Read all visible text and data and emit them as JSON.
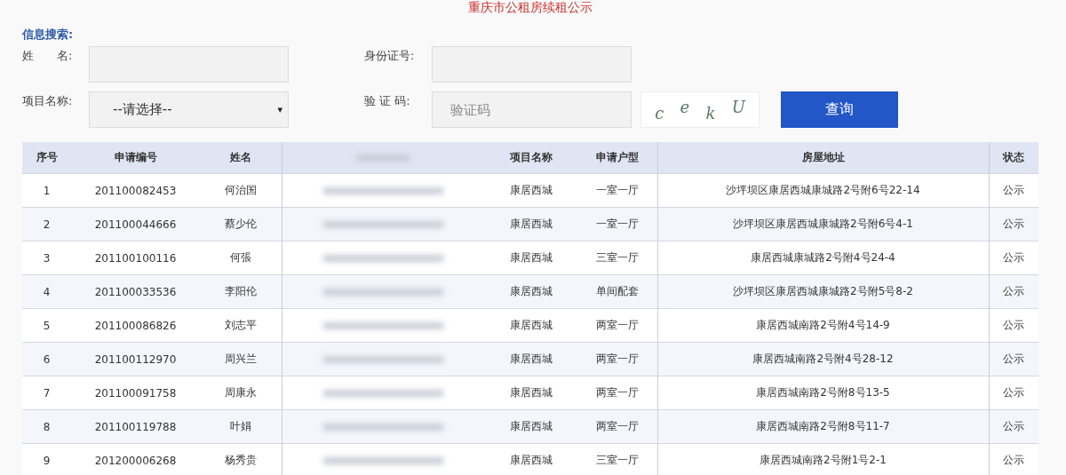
{
  "title": "重庆市公租房续租公示",
  "search": {
    "heading": "信息搜索:",
    "name_label": "姓　　名:",
    "id_label": "身份证号:",
    "project_label": "项目名称:",
    "project_select": "--请选择--",
    "project_caret": "▾",
    "code_label": "验 证 码:",
    "code_placeholder": "验证码",
    "captcha": [
      "c",
      "e",
      "k",
      "U"
    ],
    "button": "查询"
  },
  "table": {
    "columns": [
      {
        "kind": "text",
        "label": "序号"
      },
      {
        "kind": "text",
        "label": "申请编号"
      },
      {
        "kind": "text",
        "label": "姓名"
      },
      {
        "kind": "redacted"
      },
      {
        "kind": "text",
        "label": "项目名称"
      },
      {
        "kind": "text",
        "label": "申请户型"
      },
      {
        "kind": "text",
        "label": "房屋地址"
      },
      {
        "kind": "text",
        "label": "状态"
      }
    ],
    "rows": [
      [
        "1",
        "201100082453",
        "何治国",
        null,
        "康居西城",
        "一室一厅",
        "沙坪坝区康居西城康城路2号附6号22-14",
        "公示"
      ],
      [
        "2",
        "201100044666",
        "蔡少伦",
        null,
        "康居西城",
        "一室一厅",
        "沙坪坝区康居西城康城路2号附6号4-1",
        "公示"
      ],
      [
        "3",
        "201100100116",
        "何張",
        null,
        "康居西城",
        "三室一厅",
        "康居西城康城路2号附4号24-4",
        "公示"
      ],
      [
        "4",
        "201100033536",
        "李阳伦",
        null,
        "康居西城",
        "单间配套",
        "沙坪坝区康居西城康城路2号附5号8-2",
        "公示"
      ],
      [
        "5",
        "201100086826",
        "刘志平",
        null,
        "康居西城",
        "两室一厅",
        "康居西城南路2号附4号14-9",
        "公示"
      ],
      [
        "6",
        "201100112970",
        "周兴兰",
        null,
        "康居西城",
        "两室一厅",
        "康居西城南路2号附4号28-12",
        "公示"
      ],
      [
        "7",
        "201100091758",
        "周康永",
        null,
        "康居西城",
        "两室一厅",
        "康居西城南路2号附8号13-5",
        "公示"
      ],
      [
        "8",
        "201100119788",
        "叶娟",
        null,
        "康居西城",
        "两室一厅",
        "康居西城南路2号附8号11-7",
        "公示"
      ],
      [
        "9",
        "201200006268",
        "杨秀贵",
        null,
        "康居西城",
        "三室一厅",
        "康居西城南路2号附1号2-1",
        "公示"
      ]
    ]
  }
}
